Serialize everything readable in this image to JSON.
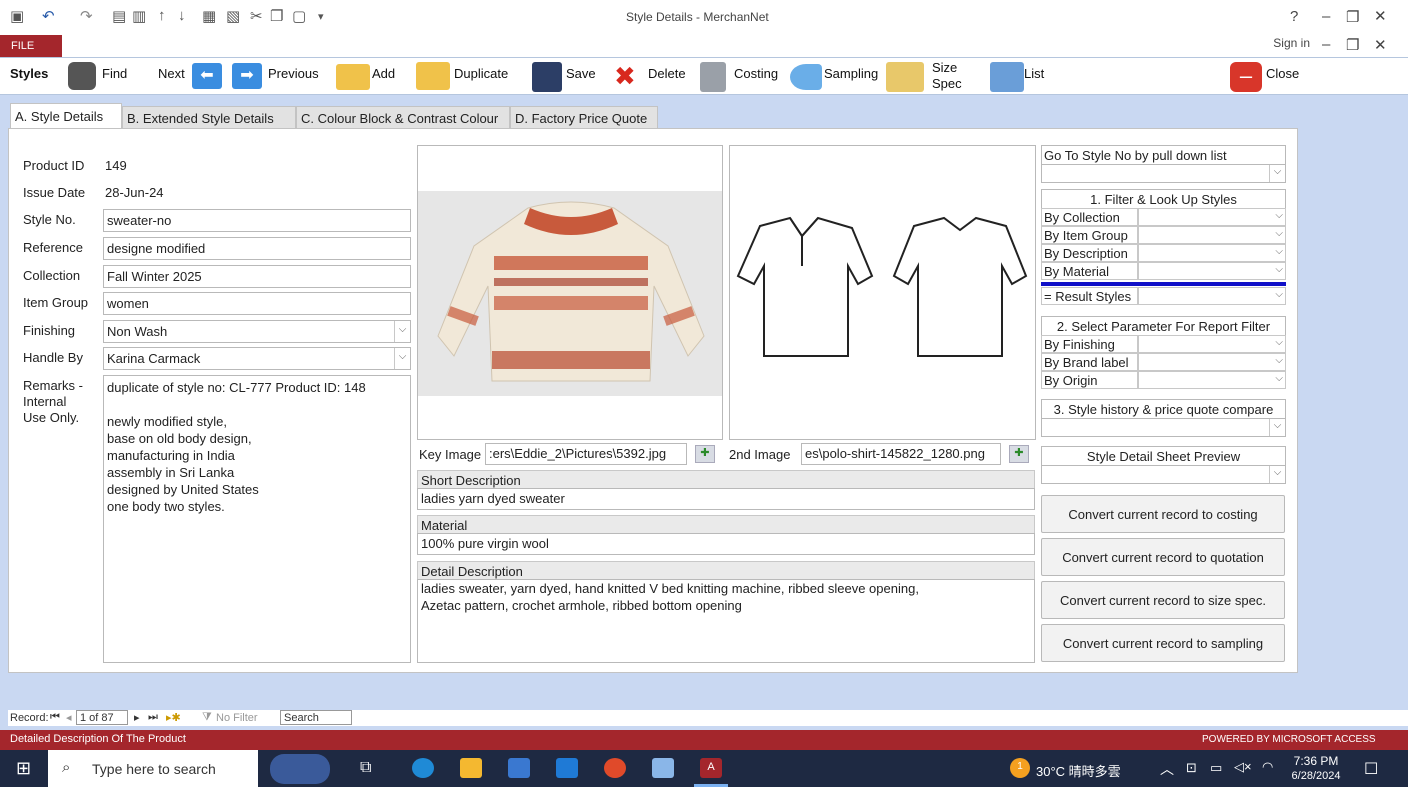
{
  "window": {
    "title": "Style Details - MerchanNet",
    "file": "FILE",
    "sign_in": "Sign in",
    "help": "?"
  },
  "ribbon": {
    "styles": "Styles",
    "find": "Find",
    "next": "Next",
    "previous": "Previous",
    "add": "Add",
    "duplicate": "Duplicate",
    "save": "Save",
    "delete": "Delete",
    "costing": "Costing",
    "sampling": "Sampling",
    "size_spec_1": "Size",
    "size_spec_2": "Spec",
    "list": "List",
    "close": "Close"
  },
  "tabs": [
    "A. Style Details",
    "B. Extended Style Details",
    "C. Colour Block & Contrast Colour",
    "D. Factory Price Quote"
  ],
  "form": {
    "product_id_label": "Product ID",
    "product_id": "149",
    "issue_date_label": "Issue Date",
    "issue_date": "28-Jun-24",
    "style_no_label": "Style No.",
    "style_no": "sweater-no",
    "reference_label": "Reference",
    "reference": "designe modified",
    "collection_label": "Collection",
    "collection": "Fall Winter 2025",
    "item_group_label": "Item Group",
    "item_group": "women",
    "finishing_label": "Finishing",
    "finishing": "Non Wash",
    "handle_by_label": "Handle By",
    "handle_by": "Karina Carmack",
    "remarks_label_1": "Remarks -",
    "remarks_label_2": "Internal",
    "remarks_label_3": "Use Only.",
    "remarks": [
      "duplicate of style no: CL-777 Product ID: 148",
      "",
      "newly modified style,",
      "base on old body design,",
      "manufacturing in India",
      "assembly in Sri Lanka",
      "designed by United States",
      "one body two styles."
    ]
  },
  "images": {
    "key_label": "Key Image",
    "key_path": ":ers\\Eddie_2\\Pictures\\5392.jpg",
    "second_label": "2nd Image",
    "second_path": "es\\polo-shirt-145822_1280.png"
  },
  "descriptions": {
    "short_label": "Short Description",
    "short": "ladies yarn dyed sweater",
    "material_label": "Material",
    "material": "100% pure virgin wool",
    "detail_label": "Detail Description",
    "detail_1": "ladies sweater, yarn dyed, hand knitted V bed knitting machine, ribbed sleeve opening,",
    "detail_2": "Azetac pattern, crochet armhole, ribbed bottom opening"
  },
  "right": {
    "goto": "Go To Style No by pull down list",
    "filter_title": "1. Filter & Look Up Styles",
    "filters": [
      "By Collection",
      "By Item Group",
      "By Description",
      "By Material"
    ],
    "result": "= Result Styles",
    "param_title": "2. Select Parameter For Report Filter",
    "params": [
      "By Finishing",
      "By Brand label",
      "By Origin"
    ],
    "history": "3. Style history & price quote compare",
    "preview": "Style Detail Sheet Preview",
    "buttons": [
      "Convert current record to costing",
      "Convert current record to quotation",
      "Convert current record to size spec.",
      "Convert current record to sampling"
    ]
  },
  "record": {
    "label": "Record:",
    "position": "1 of 87",
    "no_filter": "No Filter",
    "search": "Search"
  },
  "status": {
    "left": "Detailed Description Of The Product",
    "right": "POWERED BY MICROSOFT ACCESS"
  },
  "taskbar": {
    "search": "Type here to search",
    "weather": "30°C 晴時多雲",
    "time": "7:36 PM",
    "date": "6/28/2024",
    "badge": "1"
  },
  "colors": {
    "accent": "#a4262c",
    "bg": "#c9d8f2",
    "taskbar": "#1e2942",
    "filter_line": "#1010c8"
  }
}
